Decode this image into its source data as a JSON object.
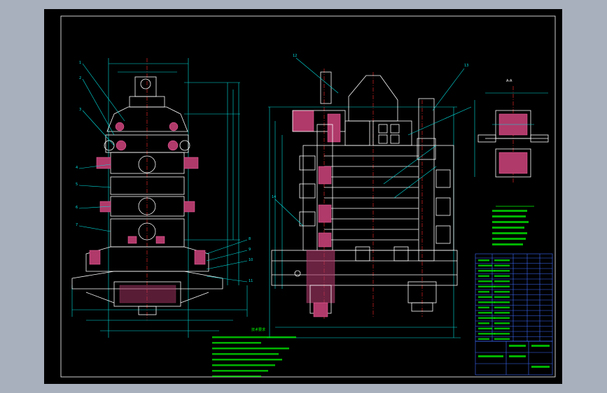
{
  "drawing": {
    "notes_title": "技术要求",
    "section_label": "A-A",
    "callouts": [
      "1",
      "2",
      "3",
      "4",
      "5",
      "6",
      "7",
      "8",
      "9",
      "10",
      "11",
      "12",
      "13",
      "14"
    ]
  },
  "colors": {
    "background": "#a9b0bd",
    "sheet": "#000000",
    "outline": "#ffffff",
    "dimension": "#00e0e0",
    "annotation": "#00ff00",
    "centerline": "#ff2a2a",
    "hatch": "#b03a6a"
  }
}
